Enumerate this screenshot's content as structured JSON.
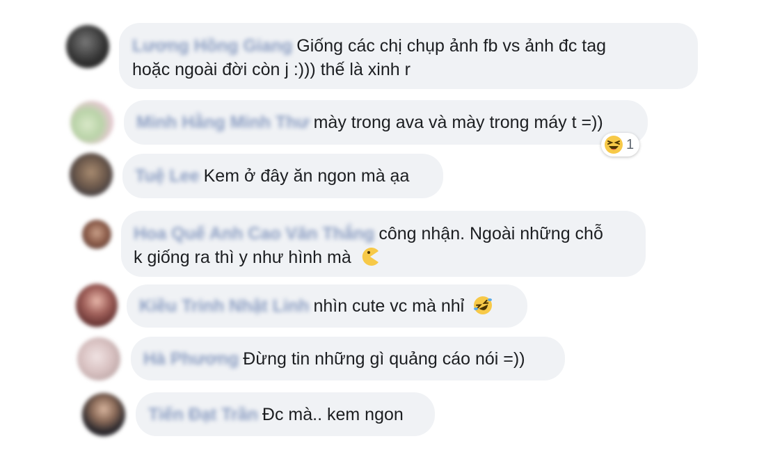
{
  "comments": [
    {
      "name": "Lương Hồng Giang",
      "line1": "Giống các chị chụp ảnh fb vs ảnh đc tag",
      "line2": "hoặc ngoài đời còn j :))) thế là xinh r"
    },
    {
      "name": "Minh Hằng Minh Thư",
      "line1": "mày trong ava và mày trong máy t =))",
      "reaction_icon": "laughing-face-icon",
      "reaction_count": "1"
    },
    {
      "name": "Tuệ Lee",
      "line1": "Kem ở đây ăn ngon mà ạa"
    },
    {
      "name": "Hoa Quế Anh Cao Văn Thắng",
      "line1": "công nhận. Ngoài những chỗ",
      "line2": "k giống ra thì y như hình mà",
      "emoji": "pacman-emoji-icon"
    },
    {
      "name": "Kiều Trinh Nhật Linh",
      "line1": "nhìn cute vc mà nhỉ",
      "emoji": "rolling-laughing-emoji-icon"
    },
    {
      "name": "Hà Phương",
      "line1": "Đừng tin những gì quảng cáo nói =))"
    },
    {
      "name": "Tiến Đạt Trần",
      "line1": "Đc mà.. kem ngon"
    }
  ],
  "colors": {
    "bubble": "#f0f2f5",
    "name": "#385898",
    "text": "#1c1e21"
  }
}
